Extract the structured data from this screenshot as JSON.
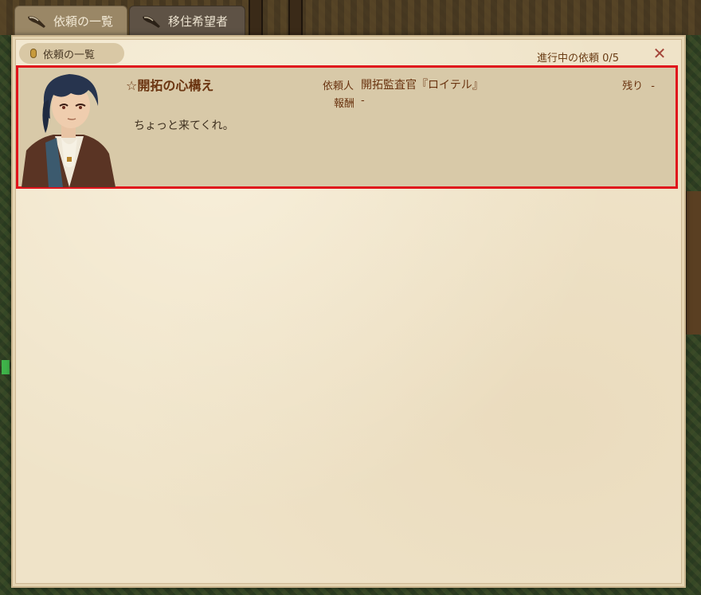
{
  "tabs": [
    {
      "label": "依頼の一覧",
      "icon": "horn-icon",
      "active": true
    },
    {
      "label": "移住希望者",
      "icon": "horn-icon",
      "active": false
    }
  ],
  "panel": {
    "sub_tab_label": "依頼の一覧",
    "active_requests_label": "進行中の依頼 0/5",
    "close_icon": "close-icon"
  },
  "request": {
    "title": "☆開拓の心構え",
    "client_label": "依頼人",
    "client_name": "開拓監査官『ロイテル』",
    "reward_label": "報酬",
    "reward_value": "-",
    "remaining_label": "残り",
    "remaining_value": "-",
    "description": "ちょっと来てくれ。",
    "portrait": "character-portrait"
  },
  "colors": {
    "highlight_border": "#e0141c",
    "accent_text": "#6a3410",
    "parchment": "#efe3c8"
  }
}
